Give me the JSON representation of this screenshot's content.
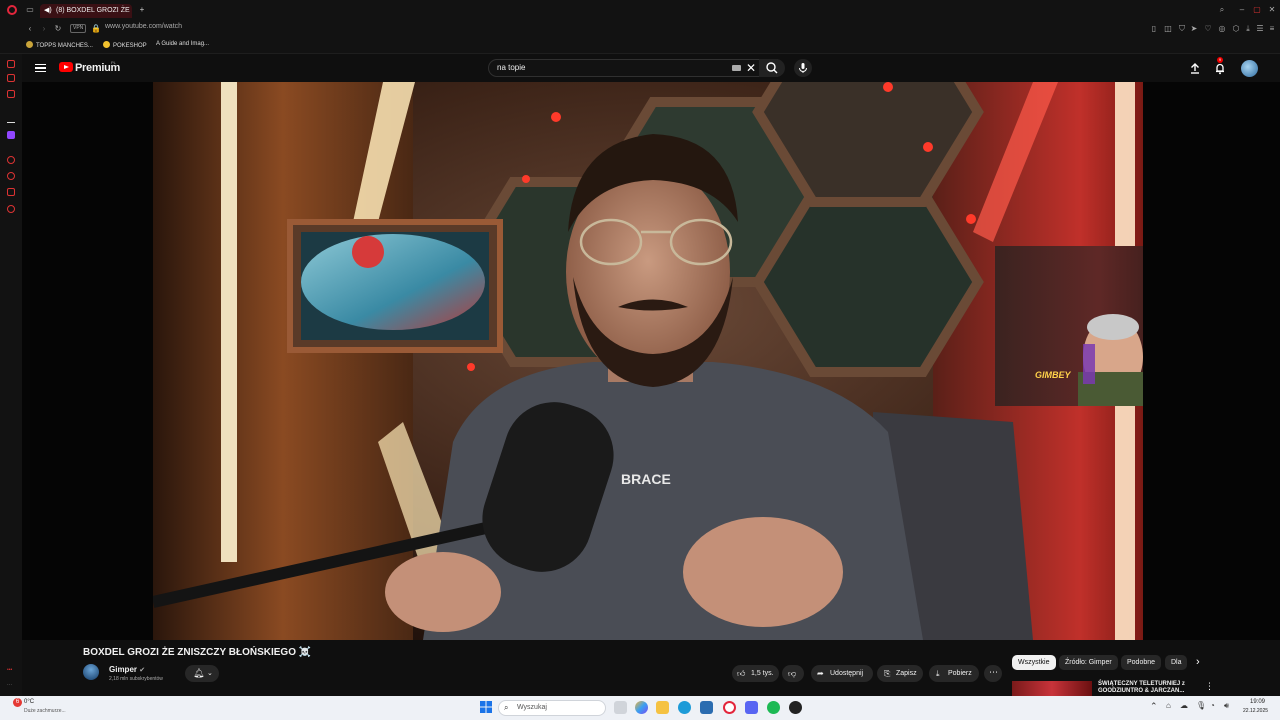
{
  "browser": {
    "tab_title": "(8) BOXDEL GROZI ŻE",
    "url": "www.youtube.com/watch",
    "vpn_label": "VPN",
    "bookmarks": [
      {
        "label": "TOPPS MANCHES...",
        "color": "#c9a43a"
      },
      {
        "label": "POKESHOP",
        "color": "#f2c12e"
      },
      {
        "label": "A Guide and Imag...",
        "color": "#888888"
      }
    ]
  },
  "youtube": {
    "logo_text": "Premium",
    "logo_region": "PL",
    "search_query": "na topie",
    "notification_count": "9"
  },
  "video": {
    "title": "BOXDEL GROZI ŻE ZNISZCZY BŁOŃSKIEGO ☠️",
    "channel": "Gimper",
    "subscribers": "2,18 mln subskrybentów",
    "likes": "1,5 tys.",
    "share_label": "Udostępnij",
    "save_label": "Zapisz",
    "download_label": "Pobierz",
    "shirt_text": "BRACE",
    "overlay_text": "GIMBEY"
  },
  "filters": {
    "chips": [
      "Wszystkie",
      "Źródło: Gimper",
      "Podobne",
      "Dla"
    ]
  },
  "recommendation": {
    "title": "ŚWIĄTECZNY TELETURNIEJ z GOODZIUNTRO & JARCZAN..."
  },
  "taskbar": {
    "temperature": "0°C",
    "weather_desc": "Duże zachmurze...",
    "weather_badge": "6",
    "search_placeholder": "Wyszukaj",
    "time": "19:09",
    "date": "22.12.2025"
  },
  "colors": {
    "accent_red": "#ff0000",
    "opera_red": "#e3263c",
    "background": "#0f0f0f",
    "taskbar": "#eef1f6"
  }
}
